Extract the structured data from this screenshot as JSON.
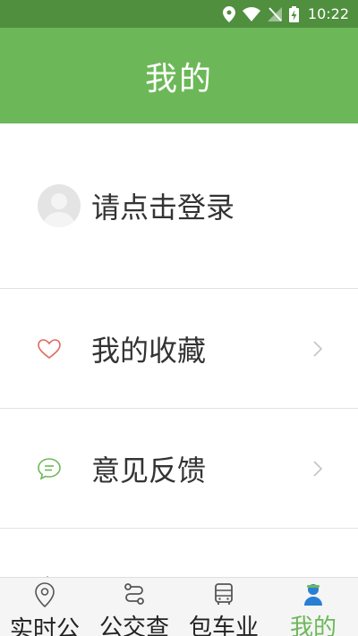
{
  "status_bar": {
    "time": "10:22"
  },
  "header": {
    "title": "我的"
  },
  "login": {
    "label": "请点击登录"
  },
  "menu": {
    "favorites": {
      "label": "我的收藏"
    },
    "feedback": {
      "label": "意见反馈"
    },
    "third": {
      "label": ""
    }
  },
  "nav": {
    "items": [
      {
        "label": "实时公"
      },
      {
        "label": "公交查"
      },
      {
        "label": "包车业"
      },
      {
        "label": "我的"
      }
    ]
  },
  "colors": {
    "status_bar": "#4f8f3e",
    "accent": "#6cb858",
    "heart": "#e06a5f"
  }
}
